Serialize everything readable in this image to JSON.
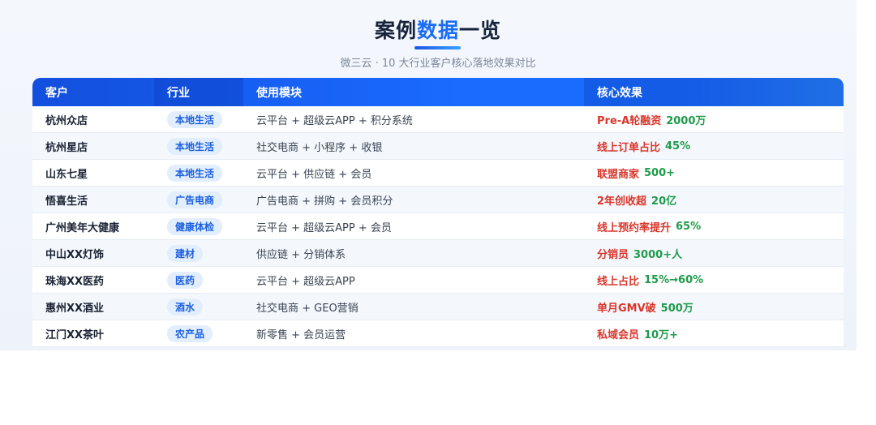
{
  "header": {
    "title_pre": "案例",
    "title_hl": "数据",
    "title_post": "一览",
    "subtitle": "微三云 · 10 大行业客户核心落地效果对比"
  },
  "table": {
    "columns": [
      "客户",
      "行业",
      "使用模块",
      "核心效果"
    ],
    "rows": [
      {
        "client": "杭州众店",
        "industry": "本地生活",
        "modules": "云平台 + 超级云APP + 积分系统",
        "effect_label": "Pre-A轮融资",
        "effect_value": "2000万"
      },
      {
        "client": "杭州星店",
        "industry": "本地生活",
        "modules": "社交电商 + 小程序 + 收银",
        "effect_label": "线上订单占比",
        "effect_value": "45%"
      },
      {
        "client": "山东七星",
        "industry": "本地生活",
        "modules": "云平台 + 供应链 + 会员",
        "effect_label": "联盟商家",
        "effect_value": "500+"
      },
      {
        "client": "悟喜生活",
        "industry": "广告电商",
        "modules": "广告电商 + 拼购 + 会员积分",
        "effect_label": "2年创收超",
        "effect_value": "20亿"
      },
      {
        "client": "广州美年大健康",
        "industry": "健康体检",
        "modules": "云平台 + 超级云APP + 会员",
        "effect_label": "线上预约率提升",
        "effect_value": "65%"
      },
      {
        "client": "中山XX灯饰",
        "industry": "建材",
        "modules": "供应链 + 分销体系",
        "effect_label": "分销员",
        "effect_value": "3000+人"
      },
      {
        "client": "珠海XX医药",
        "industry": "医药",
        "modules": "云平台 + 超级云APP",
        "effect_label": "线上占比",
        "effect_value": "15%→60%"
      },
      {
        "client": "惠州XX酒业",
        "industry": "酒水",
        "modules": "社交电商 + GEO营销",
        "effect_label": "单月GMV破",
        "effect_value": "500万"
      },
      {
        "client": "江门XX茶叶",
        "industry": "农产品",
        "modules": "新零售 + 会员运营",
        "effect_label": "私域会员",
        "effect_value": "10万+"
      }
    ]
  }
}
